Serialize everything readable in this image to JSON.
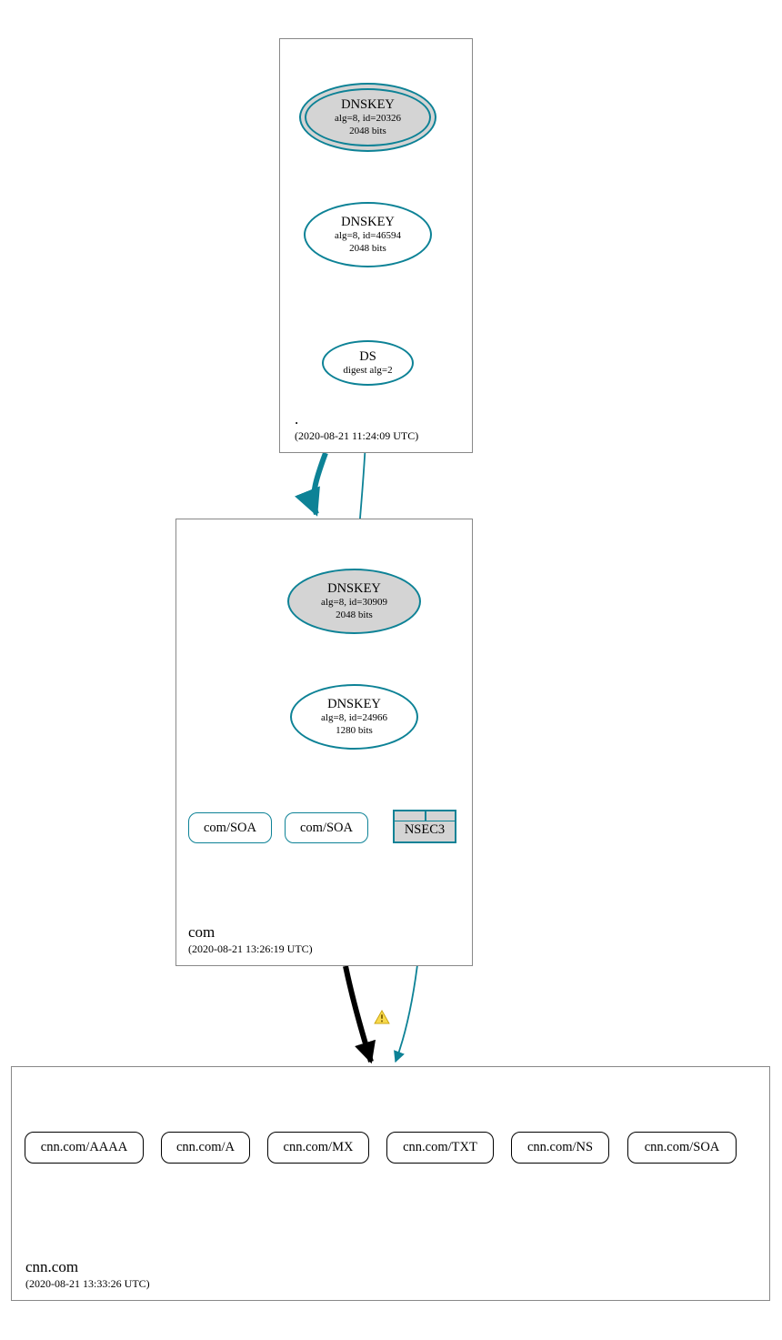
{
  "zones": {
    "root": {
      "name": ".",
      "timestamp": "(2020-08-21 11:24:09 UTC)",
      "dnskey_ksk": {
        "title": "DNSKEY",
        "line2": "alg=8, id=20326",
        "line3": "2048 bits"
      },
      "dnskey_zsk": {
        "title": "DNSKEY",
        "line2": "alg=8, id=46594",
        "line3": "2048 bits"
      },
      "ds": {
        "title": "DS",
        "line2": "digest alg=2"
      }
    },
    "com": {
      "name": "com",
      "timestamp": "(2020-08-21 13:26:19 UTC)",
      "dnskey_ksk": {
        "title": "DNSKEY",
        "line2": "alg=8, id=30909",
        "line3": "2048 bits"
      },
      "dnskey_zsk": {
        "title": "DNSKEY",
        "line2": "alg=8, id=24966",
        "line3": "1280 bits"
      },
      "rrset1": "com/SOA",
      "rrset2": "com/SOA",
      "nsec3": "NSEC3"
    },
    "cnn": {
      "name": "cnn.com",
      "timestamp": "(2020-08-21 13:33:26 UTC)",
      "records": [
        "cnn.com/AAAA",
        "cnn.com/A",
        "cnn.com/MX",
        "cnn.com/TXT",
        "cnn.com/NS",
        "cnn.com/SOA"
      ]
    }
  }
}
